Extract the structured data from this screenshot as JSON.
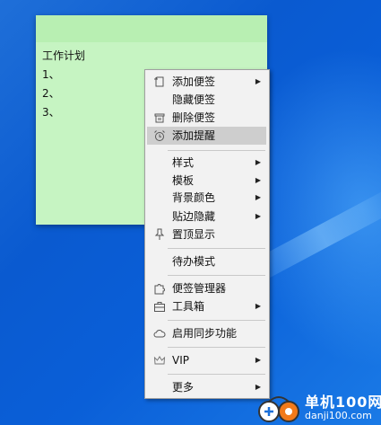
{
  "note": {
    "lines": [
      "工作计划",
      "1、",
      "2、",
      "3、"
    ],
    "color": "#c6f4c2"
  },
  "menu": {
    "items": [
      {
        "label": "添加便签",
        "icon": "add-note-icon",
        "submenu": true
      },
      {
        "label": "隐藏便签",
        "icon": "",
        "submenu": false
      },
      {
        "label": "删除便签",
        "icon": "trash-icon",
        "submenu": false
      },
      {
        "label": "添加提醒",
        "icon": "alarm-clock-icon",
        "submenu": false,
        "highlighted": true
      },
      {
        "label": "样式",
        "icon": "",
        "submenu": true
      },
      {
        "label": "模板",
        "icon": "",
        "submenu": true
      },
      {
        "label": "背景颜色",
        "icon": "",
        "submenu": true
      },
      {
        "label": "贴边隐藏",
        "icon": "",
        "submenu": true
      },
      {
        "label": "置顶显示",
        "icon": "pin-icon",
        "submenu": false
      },
      {
        "label": "待办模式",
        "icon": "",
        "submenu": false
      },
      {
        "label": "便签管理器",
        "icon": "puzzle-icon",
        "submenu": false
      },
      {
        "label": "工具箱",
        "icon": "toolbox-icon",
        "submenu": true
      },
      {
        "label": "启用同步功能",
        "icon": "cloud-icon",
        "submenu": false
      },
      {
        "label": "VIP",
        "icon": "crown-icon",
        "submenu": true
      },
      {
        "label": "更多",
        "icon": "",
        "submenu": true
      }
    ],
    "highlight_color": "#cecece"
  },
  "watermark": {
    "name": "单机100网",
    "url": "danji100.com"
  }
}
